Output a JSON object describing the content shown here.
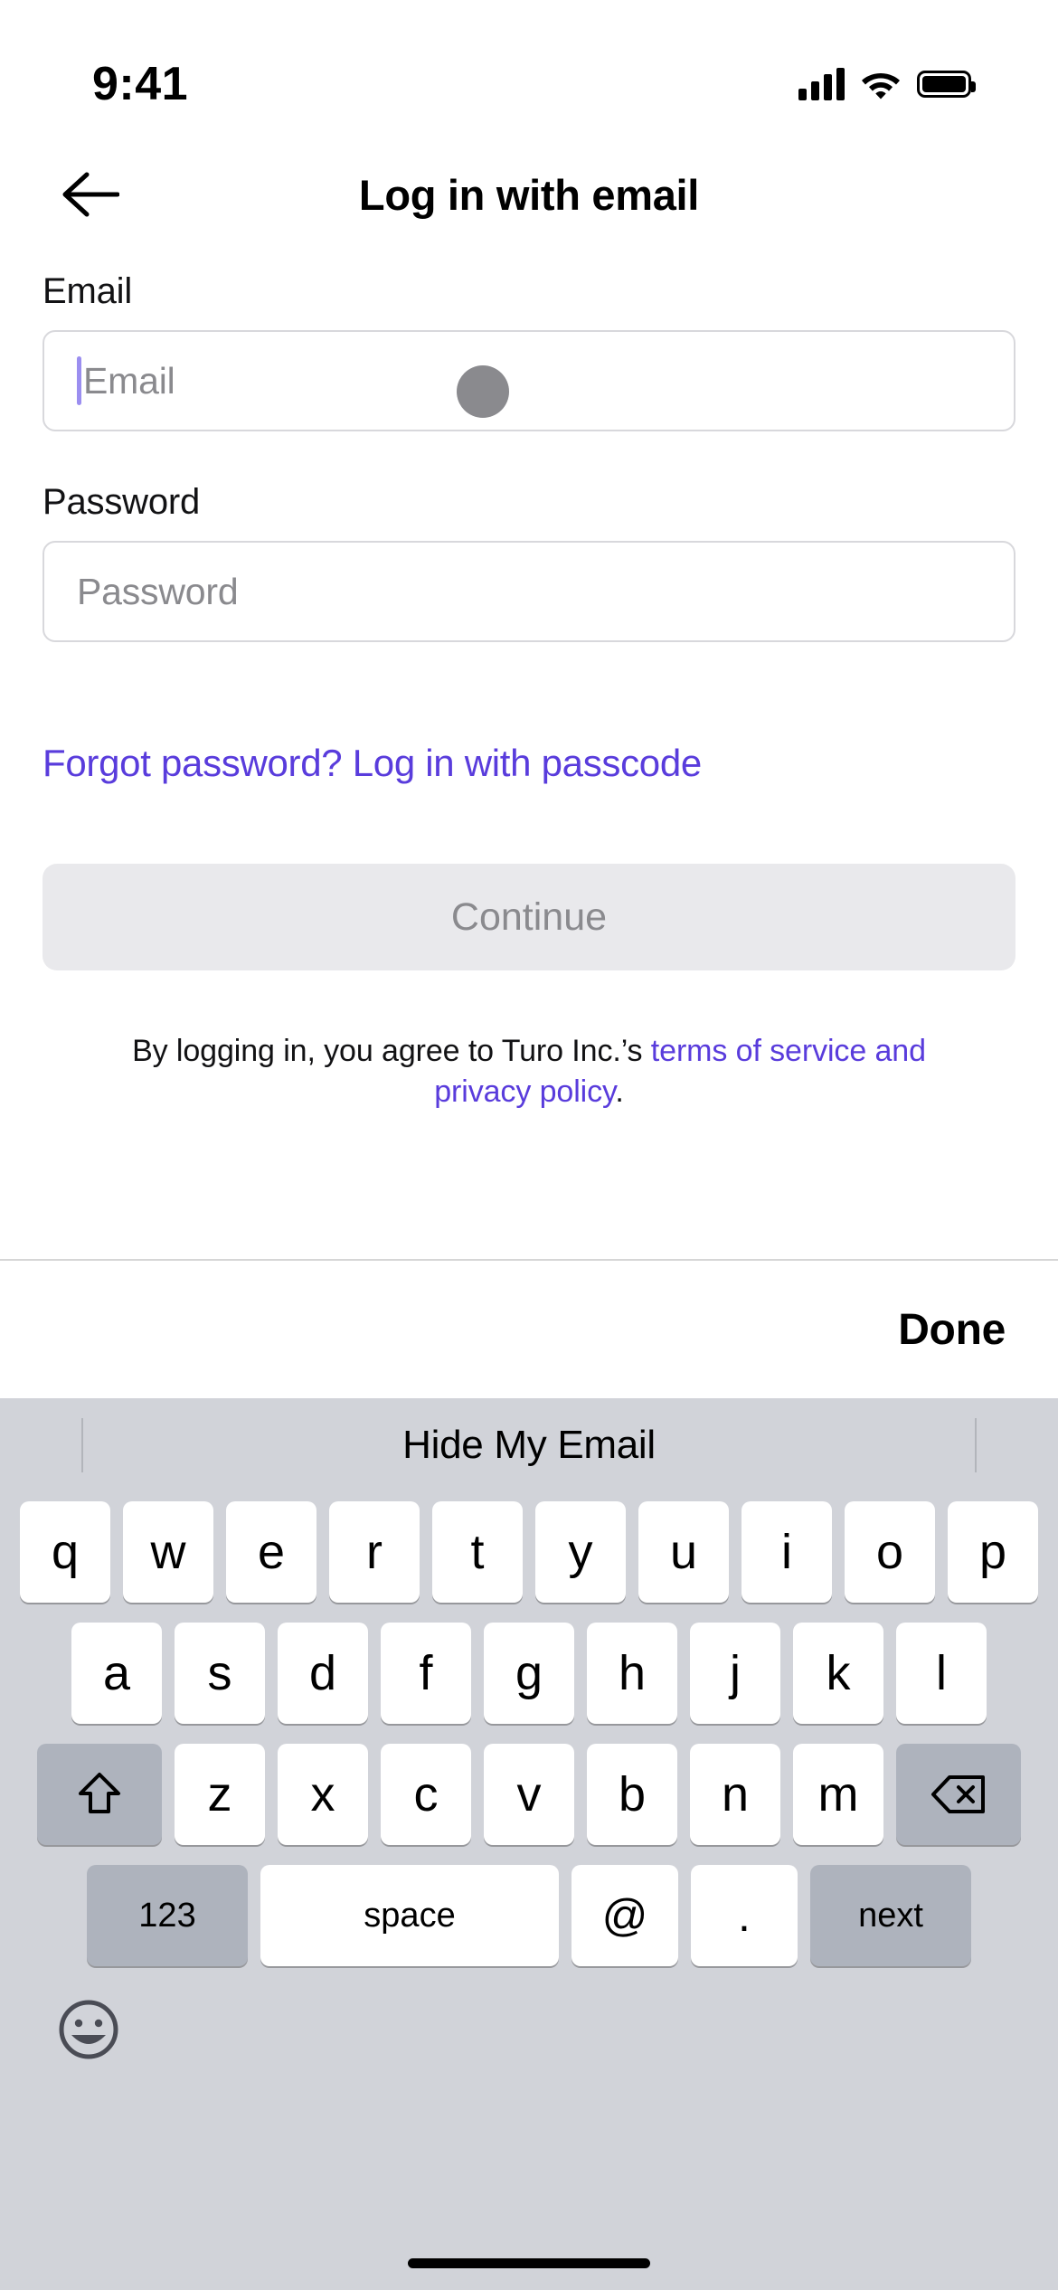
{
  "status_bar": {
    "time": "9:41",
    "cellular_icon": "signal-bars-icon",
    "wifi_icon": "wifi-icon",
    "battery_icon": "battery-full-icon"
  },
  "nav": {
    "back_icon": "back-arrow-icon",
    "title": "Log in with email"
  },
  "form": {
    "email": {
      "label": "Email",
      "placeholder": "Email",
      "value": ""
    },
    "password": {
      "label": "Password",
      "placeholder": "Password",
      "value": ""
    },
    "forgot_link": "Forgot password? Log in with passcode",
    "continue_label": "Continue",
    "legal_prefix": "By logging in, you agree to Turo Inc.’s ",
    "legal_link": "terms of service and privacy policy",
    "legal_suffix": "."
  },
  "accessory_bar": {
    "done_label": "Done"
  },
  "keyboard": {
    "suggestion": "Hide My Email",
    "row1": [
      "q",
      "w",
      "e",
      "r",
      "t",
      "y",
      "u",
      "i",
      "o",
      "p"
    ],
    "row2": [
      "a",
      "s",
      "d",
      "f",
      "g",
      "h",
      "j",
      "k",
      "l"
    ],
    "row3_letters": [
      "z",
      "x",
      "c",
      "v",
      "b",
      "n",
      "m"
    ],
    "shift_icon": "shift-arrow-icon",
    "backspace_icon": "backspace-icon",
    "numbers_label": "123",
    "space_label": "space",
    "at_label": "@",
    "dot_label": ".",
    "next_label": "next",
    "emoji_icon": "emoji-smiley-icon"
  },
  "colors": {
    "accent_purple": "#593cdc",
    "caret_purple": "#9b8ef0",
    "keyboard_bg": "#d1d3d9",
    "key_dark": "#aeb3bd",
    "disabled_button_bg": "#e9e9ec",
    "placeholder_gray": "#8a8a8e"
  }
}
